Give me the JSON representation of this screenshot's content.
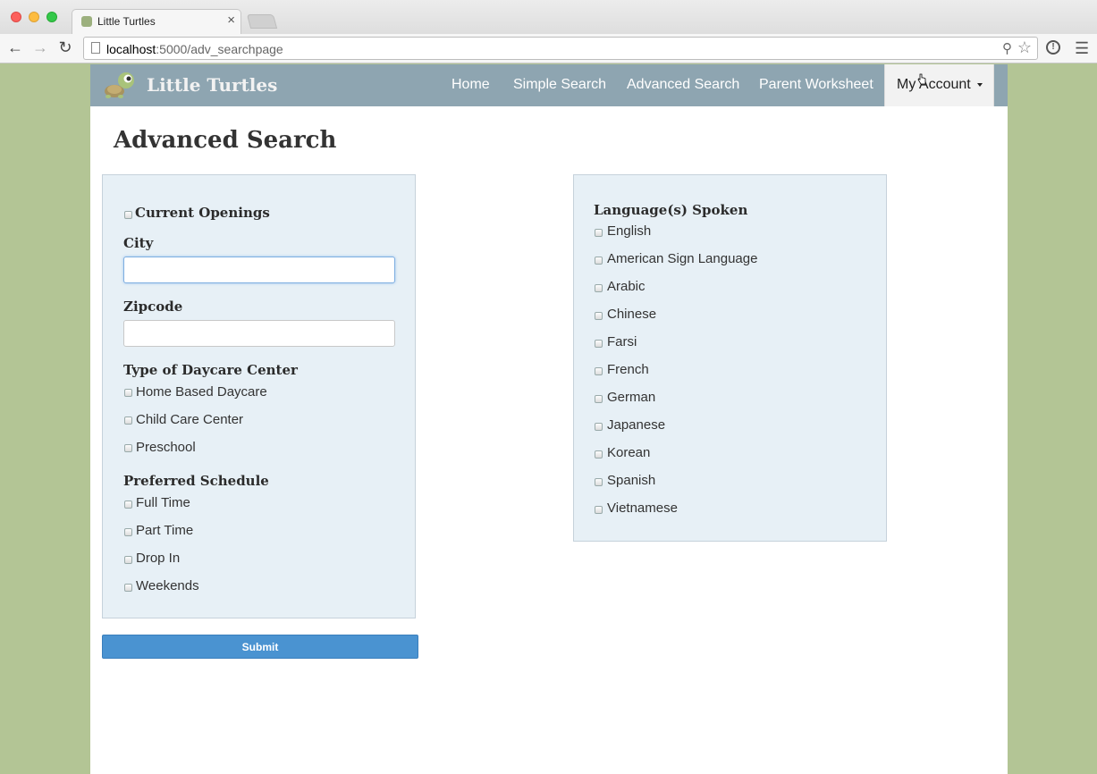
{
  "browser": {
    "tab_title": "Little Turtles",
    "tab_close": "×",
    "url_host": "localhost",
    "url_path": ":5000/adv_searchpage",
    "icons": {
      "back": "arrow-left-icon",
      "forward": "arrow-right-icon",
      "reload": "reload-icon",
      "zoom": "magnifier-icon",
      "bookmark": "star-icon",
      "extension": "extension-icon",
      "menu": "hamburger-menu-icon"
    }
  },
  "navbar": {
    "brand": "Little Turtles",
    "links": {
      "home": "Home",
      "simple": "Simple Search",
      "advanced": "Advanced Search",
      "parent": "Parent Worksheet"
    },
    "account": "My Account",
    "colors": {
      "navbar_bg": "#8ea5b1",
      "page_bg": "#b3c595"
    }
  },
  "page": {
    "title": "Advanced Search"
  },
  "left_panel": {
    "current_openings": "Current Openings",
    "city_label": "City",
    "city_value": "",
    "zipcode_label": "Zipcode",
    "zipcode_value": "",
    "daycare_type_title": "Type of Daycare Center",
    "daycare_types": [
      "Home Based Daycare",
      "Child Care Center",
      "Preschool"
    ],
    "schedule_title": "Preferred Schedule",
    "schedules": [
      "Full Time",
      "Part Time",
      "Drop In",
      "Weekends"
    ]
  },
  "right_panel": {
    "title": "Language(s) Spoken",
    "languages": [
      "English",
      "American Sign Language",
      "Arabic",
      "Chinese",
      "Farsi",
      "French",
      "German",
      "Japanese",
      "Korean",
      "Spanish",
      "Vietnamese"
    ]
  },
  "form": {
    "submit_label": "Submit",
    "submit_color": "#4a93d1"
  }
}
